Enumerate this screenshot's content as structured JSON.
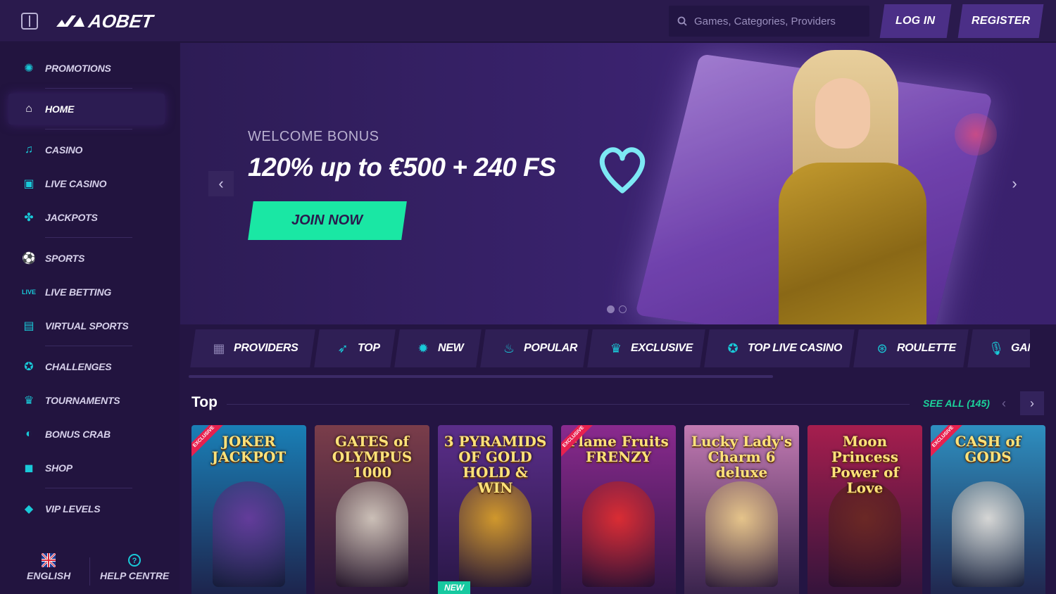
{
  "header": {
    "brand": "AOBET",
    "search_placeholder": "Games, Categories, Providers",
    "login_label": "LOG IN",
    "register_label": "REGISTER"
  },
  "sidebar": {
    "items": [
      {
        "label": "PROMOTIONS",
        "icon": "promotions-icon"
      },
      {
        "label": "HOME",
        "icon": "home-icon",
        "active": true
      },
      {
        "label": "CASINO",
        "icon": "casino-icon"
      },
      {
        "label": "LIVE CASINO",
        "icon": "live-casino-icon"
      },
      {
        "label": "JACKPOTS",
        "icon": "jackpots-icon"
      },
      {
        "label": "SPORTS",
        "icon": "sports-icon"
      },
      {
        "label": "LIVE BETTING",
        "icon": "live-betting-icon"
      },
      {
        "label": "VIRTUAL SPORTS",
        "icon": "virtual-sports-icon"
      },
      {
        "label": "CHALLENGES",
        "icon": "challenges-icon"
      },
      {
        "label": "TOURNAMENTS",
        "icon": "tournaments-icon"
      },
      {
        "label": "BONUS CRAB",
        "icon": "bonus-crab-icon"
      },
      {
        "label": "SHOP",
        "icon": "shop-icon"
      },
      {
        "label": "VIP LEVELS",
        "icon": "vip-icon"
      }
    ],
    "footer": {
      "language_label": "ENGLISH",
      "help_label": "HELP CENTRE"
    }
  },
  "banner": {
    "eyebrow": "WELCOME BONUS",
    "headline": "120% up to €500 + 240 FS",
    "cta_label": "JOIN NOW",
    "slide_count": 2,
    "active_slide": 1
  },
  "categories": [
    {
      "label": "PROVIDERS",
      "icon": "providers-icon"
    },
    {
      "label": "TOP",
      "icon": "rocket-icon"
    },
    {
      "label": "NEW",
      "icon": "new-icon"
    },
    {
      "label": "POPULAR",
      "icon": "flame-icon"
    },
    {
      "label": "EXCLUSIVE",
      "icon": "crown-icon"
    },
    {
      "label": "TOP LIVE CASINO",
      "icon": "live-star-icon"
    },
    {
      "label": "ROULETTE",
      "icon": "roulette-icon"
    },
    {
      "label": "GAME SHOWS",
      "icon": "microphone-icon"
    }
  ],
  "top_section": {
    "title": "Top",
    "see_all_label": "SEE ALL (145)"
  },
  "games": [
    {
      "title": "JOKER JACKPOT",
      "exclusive": true,
      "new": false,
      "bg": "#1a7fb6",
      "art": "#6b3a9e"
    },
    {
      "title": "GATES of OLYMPUS 1000",
      "exclusive": false,
      "new": false,
      "bg": "#7a3d4a",
      "art": "#d9d0c4"
    },
    {
      "title": "3 PYRAMIDS OF GOLD HOLD & WIN",
      "exclusive": false,
      "new": true,
      "bg": "#5b2e8a",
      "art": "#e0a526"
    },
    {
      "title": "Flame Fruits FRENZY",
      "exclusive": true,
      "new": false,
      "bg": "#8a2a8e",
      "art": "#e82e2e"
    },
    {
      "title": "Lucky Lady's Charm 6 deluxe",
      "exclusive": false,
      "new": false,
      "bg": "#c27ab2",
      "art": "#f1d18c"
    },
    {
      "title": "Moon Princess Power of Love",
      "exclusive": false,
      "new": false,
      "bg": "#a61e4e",
      "art": "#6b2a22"
    },
    {
      "title": "CASH of GODS",
      "exclusive": true,
      "new": false,
      "bg": "#2e8fc0",
      "art": "#e9e4de"
    }
  ],
  "colors": {
    "accent_teal": "#19c9d8",
    "cta_green": "#1ae7a4",
    "button_purple": "#4b2f87",
    "see_all_green": "#1bd49b"
  }
}
